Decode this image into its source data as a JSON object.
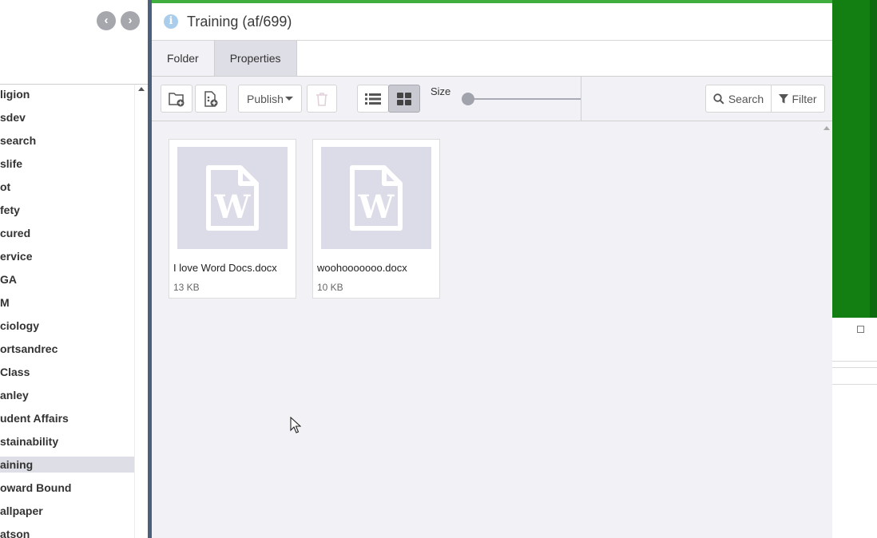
{
  "sidebar": {
    "nav_prev_icon": "chevron-left-circle-icon",
    "nav_next_icon": "chevron-right-circle-icon",
    "items": [
      {
        "label": "ligion"
      },
      {
        "label": "sdev"
      },
      {
        "label": "search"
      },
      {
        "label": "slife"
      },
      {
        "label": "ot"
      },
      {
        "label": "fety"
      },
      {
        "label": "cured"
      },
      {
        "label": "ervice"
      },
      {
        "label": "GA"
      },
      {
        "label": "M"
      },
      {
        "label": "ciology"
      },
      {
        "label": "ortsandrec"
      },
      {
        "label": "Class"
      },
      {
        "label": "anley"
      },
      {
        "label": "udent Affairs"
      },
      {
        "label": "stainability"
      },
      {
        "label": "aining",
        "active": true
      },
      {
        "label": "oward Bound"
      },
      {
        "label": "allpaper"
      },
      {
        "label": "atson"
      }
    ]
  },
  "panel": {
    "title": "Training (af/699)",
    "info_icon": "info-circle-icon",
    "tabs": [
      {
        "label": "Folder",
        "active": true
      },
      {
        "label": "Properties",
        "active": false
      }
    ]
  },
  "toolbar": {
    "publish_label": "Publish",
    "size_label": "Size",
    "search_label": "Search",
    "filter_label": "Filter",
    "view_mode": "grid"
  },
  "files": [
    {
      "name": "I love Word Docs.docx",
      "size": "13 KB",
      "icon": "word-doc-icon"
    },
    {
      "name": "woohooooooo.docx",
      "size": "10 KB",
      "icon": "word-doc-icon"
    }
  ],
  "colors": {
    "accent_green": "#3fae3f",
    "background_window_green": "#137f13",
    "panel_bg": "#f2f1f5",
    "thumb_bg": "#dcdce8"
  }
}
